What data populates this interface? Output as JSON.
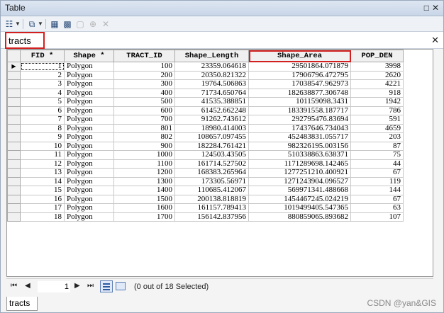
{
  "window": {
    "title": "Table"
  },
  "tabs": {
    "active": "tracts",
    "bottom": "tracts"
  },
  "toolbar": {
    "icons": [
      "table-options-icon",
      "related-tables-icon",
      "select-by-attributes-icon",
      "switch-selection-icon",
      "clear-selection-icon",
      "zoom-to-selected-icon",
      "delete-selected-icon"
    ]
  },
  "table": {
    "columns": [
      "FID *",
      "Shape *",
      "TRACT_ID",
      "Shape_Length",
      "Shape_Area",
      "POP_DEN"
    ],
    "rows": [
      [
        "1",
        "Polygon",
        "100",
        "23359.064618",
        "29501864.071879",
        "3998"
      ],
      [
        "2",
        "Polygon",
        "200",
        "20350.821322",
        "17906796.472795",
        "2620"
      ],
      [
        "3",
        "Polygon",
        "300",
        "19764.506863",
        "17038547.962973",
        "4221"
      ],
      [
        "4",
        "Polygon",
        "400",
        "71734.650764",
        "182638877.306748",
        "918"
      ],
      [
        "5",
        "Polygon",
        "500",
        "41535.388851",
        "101159098.3431",
        "1942"
      ],
      [
        "6",
        "Polygon",
        "600",
        "61452.662248",
        "183391558.187717",
        "786"
      ],
      [
        "7",
        "Polygon",
        "700",
        "91262.743612",
        "292795476.83694",
        "591"
      ],
      [
        "8",
        "Polygon",
        "801",
        "18980.414003",
        "17437646.734043",
        "4659"
      ],
      [
        "9",
        "Polygon",
        "802",
        "108657.097455",
        "452483831.055717",
        "203"
      ],
      [
        "10",
        "Polygon",
        "900",
        "182284.761421",
        "982326195.003156",
        "87"
      ],
      [
        "11",
        "Polygon",
        "1000",
        "124503.43505",
        "510338863.638371",
        "75"
      ],
      [
        "12",
        "Polygon",
        "1100",
        "161714.527502",
        "1171289698.142465",
        "44"
      ],
      [
        "13",
        "Polygon",
        "1200",
        "168383.265964",
        "1277251210.400921",
        "67"
      ],
      [
        "14",
        "Polygon",
        "1300",
        "173305.56971",
        "1271243904.096527",
        "119"
      ],
      [
        "15",
        "Polygon",
        "1400",
        "110685.412067",
        "569971341.488668",
        "144"
      ],
      [
        "16",
        "Polygon",
        "1500",
        "200138.818819",
        "1454467245.024219",
        "67"
      ],
      [
        "17",
        "Polygon",
        "1600",
        "161157.789413",
        "1019499405.547365",
        "63"
      ],
      [
        "18",
        "Polygon",
        "1700",
        "156142.837956",
        "880859065.893682",
        "107"
      ]
    ]
  },
  "navigation": {
    "current_record": "1",
    "selection_status": "(0 out of 18 Selected)"
  },
  "watermark": "CSDN @yan&GIS",
  "colors": {
    "highlight": "#d21f1f",
    "accent": "#2c5aa0"
  }
}
